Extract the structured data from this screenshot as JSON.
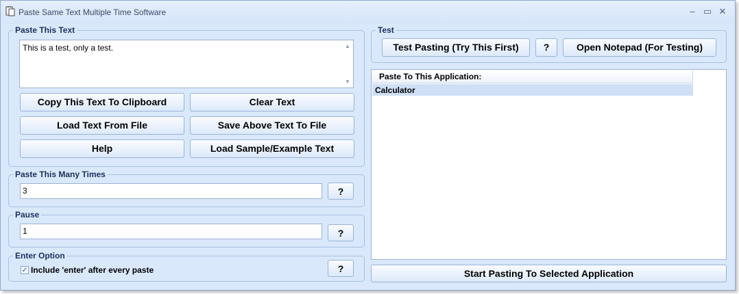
{
  "window": {
    "title": "Paste Same Text Multiple Time Software",
    "minimize": "–",
    "maximize": "▭",
    "close": "✕"
  },
  "paste_text": {
    "legend": "Paste This Text",
    "value": "This is a test, only a test.",
    "buttons": {
      "copy": "Copy This Text To Clipboard",
      "clear": "Clear Text",
      "load": "Load Text From File",
      "save": "Save Above Text To File",
      "help": "Help",
      "sample": "Load Sample/Example Text"
    }
  },
  "times": {
    "legend": "Paste This Many Times",
    "value": "3",
    "help": "?"
  },
  "pause": {
    "legend": "Pause",
    "value": "1",
    "help": "?"
  },
  "enter_option": {
    "legend": "Enter Option",
    "checkbox_label": "Include 'enter' after every paste",
    "checked": true,
    "check_glyph": "✓",
    "help": "?"
  },
  "test": {
    "legend": "Test",
    "test_pasting": "Test Pasting (Try This First)",
    "help": "?",
    "open_notepad": "Open Notepad (For Testing)"
  },
  "app_list": {
    "header": "Paste To This Application:",
    "rows": [
      "Calculator"
    ]
  },
  "start_button": "Start Pasting To Selected Application",
  "icons": {
    "app": "clipboard-icon",
    "scroll_up": "▲",
    "scroll_down": "▼"
  }
}
